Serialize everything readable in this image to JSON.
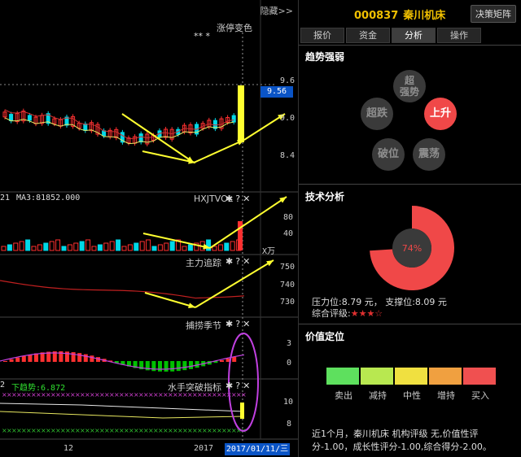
{
  "chart": {
    "hide_label": "隐藏>>",
    "limit_change_label": "涨停变色",
    "marks": "**   *",
    "price_labels": [
      "9.6",
      "9.0",
      "8.4"
    ],
    "current_price": "9.56",
    "vol_panel": {
      "left_label": "21",
      "ma_label": "MA3:81852.000",
      "name": "HXJTVOL",
      "axis_labels": [
        "80",
        "40"
      ],
      "unit": "X万"
    },
    "main_panel": {
      "name": "主力追踪",
      "axis_labels": [
        "750",
        "740",
        "730"
      ]
    },
    "season_panel": {
      "name": "捕捞季节",
      "axis_labels": [
        "3",
        "0"
      ]
    },
    "breakout_panel": {
      "left_label": "2",
      "trend_label": "下趋势:6.872",
      "name": "水手突破指标",
      "axis_labels": [
        "10",
        "8"
      ]
    },
    "x_labels": [
      "12",
      "2017"
    ],
    "date_box": "2017/01/11/三",
    "colors": {
      "up": "#ff3030",
      "down": "#00d8e8",
      "yellow": "#ffff30",
      "purple": "#c040e0",
      "green": "#00c000",
      "blue": "#0a54c6"
    }
  },
  "panel": {
    "stock_code": "000837",
    "stock_name": "秦川机床",
    "decision_button": "决策矩阵",
    "tabs": [
      {
        "label": "报价"
      },
      {
        "label": "资金"
      },
      {
        "label": "分析"
      },
      {
        "label": "操作"
      }
    ],
    "trend": {
      "title": "趋势强弱",
      "super_strong": "超\n强势",
      "super_drop": "超跌",
      "rise": "上升",
      "break": "破位",
      "shock": "震荡"
    },
    "tech": {
      "title": "技术分析",
      "percent_label": "74%",
      "percent_value": 74,
      "pressure_support": "压力位:8.79 元， 支撑位:8.09 元",
      "rating_label": "综合评级:",
      "stars": "★★★☆"
    },
    "value": {
      "title": "价值定位",
      "cells": [
        {
          "label": "卖出",
          "color": "#5ee05e"
        },
        {
          "label": "减持",
          "color": "#b8e850"
        },
        {
          "label": "中性",
          "color": "#f0e040"
        },
        {
          "label": "增持",
          "color": "#f0a040"
        },
        {
          "label": "买入",
          "color": "#f05050"
        }
      ],
      "summary": "近1个月，秦川机床 机构评级 无,价值性评分-1.00，成长性评分-1.00,综合得分-2.00。"
    }
  }
}
